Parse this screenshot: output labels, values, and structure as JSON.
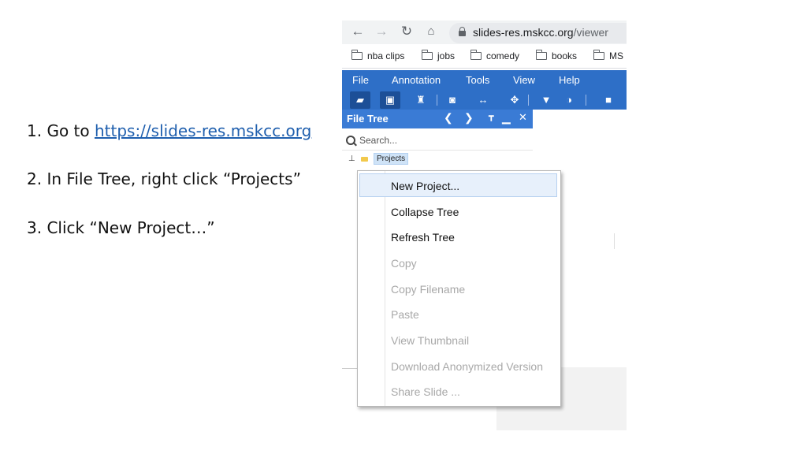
{
  "instructions": {
    "step1_prefix": "1. Go to ",
    "step1_link": "https://slides-res.mskcc.org",
    "step2": "2. In File Tree, right click “Projects”",
    "step3": "3. Click “New Project…”"
  },
  "browser": {
    "url_host": "slides-res.mskcc.org",
    "url_path": "/viewer",
    "bookmarks": [
      "nba clips",
      "jobs",
      "comedy",
      "books",
      "MS"
    ]
  },
  "app": {
    "menu": [
      "File",
      "Annotation",
      "Tools",
      "View",
      "Help"
    ],
    "panel_title": "File Tree",
    "search_placeholder": "Search...",
    "tree_root": "Projects",
    "accent": "#2e6fc7"
  },
  "context_menu": {
    "items": [
      {
        "label": "New Project...",
        "enabled": true
      },
      {
        "label": "Collapse Tree",
        "enabled": true
      },
      {
        "label": "Refresh Tree",
        "enabled": true
      },
      {
        "label": "Copy",
        "enabled": false
      },
      {
        "label": "Copy Filename",
        "enabled": false
      },
      {
        "label": "Paste",
        "enabled": false
      },
      {
        "label": "View Thumbnail",
        "enabled": false
      },
      {
        "label": "Download Anonymized Version",
        "enabled": false
      },
      {
        "label": "Share Slide ...",
        "enabled": false
      }
    ]
  }
}
